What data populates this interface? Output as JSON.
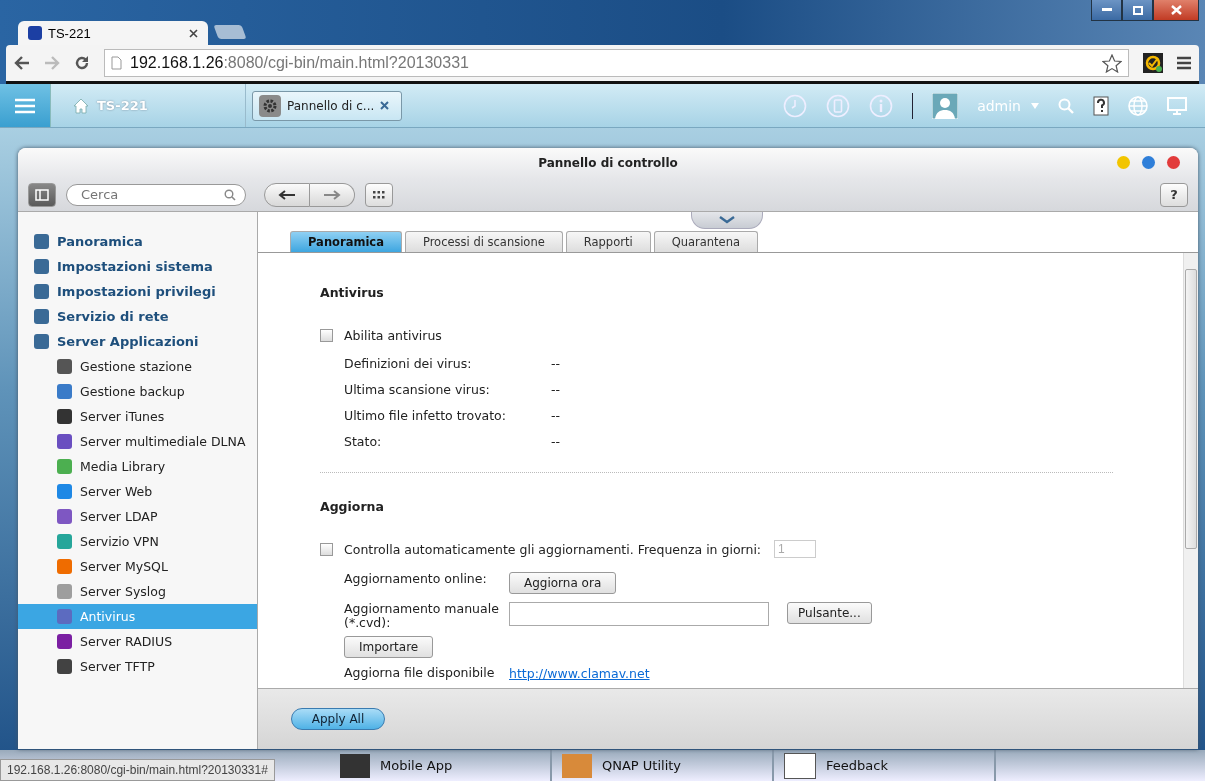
{
  "browser": {
    "tab_title": "TS-221",
    "url_host": "192.168.1.26",
    "url_path": ":8080/cgi-bin/main.html?20130331"
  },
  "topbar": {
    "home_label": "TS-221",
    "app_tab": "Pannello di c...",
    "user": "admin"
  },
  "window": {
    "title": "Pannello di controllo",
    "search": {
      "placeholder": "Cerca"
    },
    "help": "?"
  },
  "sidebar": {
    "items": [
      {
        "label": "Panoramica",
        "selected": false
      },
      {
        "label": "Impostazioni sistema",
        "selected": false
      },
      {
        "label": "Impostazioni privilegi",
        "selected": false
      },
      {
        "label": "Servizio di rete",
        "selected": false
      },
      {
        "label": "Server Applicazioni",
        "selected": false,
        "children": [
          {
            "label": "Gestione stazione",
            "selected": false
          },
          {
            "label": "Gestione backup",
            "selected": false
          },
          {
            "label": "Server iTunes",
            "selected": false
          },
          {
            "label": "Server multimediale DLNA",
            "selected": false
          },
          {
            "label": "Media Library",
            "selected": false
          },
          {
            "label": "Server Web",
            "selected": false
          },
          {
            "label": "Server LDAP",
            "selected": false
          },
          {
            "label": "Servizio VPN",
            "selected": false
          },
          {
            "label": "Server MySQL",
            "selected": false
          },
          {
            "label": "Server Syslog",
            "selected": false
          },
          {
            "label": "Antivirus",
            "selected": true
          },
          {
            "label": "Server RADIUS",
            "selected": false
          },
          {
            "label": "Server TFTP",
            "selected": false
          }
        ]
      }
    ]
  },
  "tabs": [
    {
      "label": "Panoramica",
      "selected": true
    },
    {
      "label": "Processi di scansione",
      "selected": false
    },
    {
      "label": "Rapporti",
      "selected": false
    },
    {
      "label": "Quarantena",
      "selected": false
    }
  ],
  "antivirus": {
    "heading": "Antivirus",
    "enable": {
      "label": "Abilita antivirus",
      "checked": false
    },
    "fields": [
      {
        "label": "Definizioni dei virus:",
        "value": "--"
      },
      {
        "label": "Ultima scansione virus:",
        "value": "--"
      },
      {
        "label": "Ultimo file infetto trovato:",
        "value": "--"
      },
      {
        "label": "Stato:",
        "value": "--"
      }
    ]
  },
  "update": {
    "heading": "Aggiorna",
    "auto": {
      "label": "Controlla automaticamente gli aggiornamenti. Frequenza in giorni:",
      "checked": false,
      "value": "1",
      "disabled": true
    },
    "online": {
      "label": "Aggiornamento online:",
      "button": "Aggiorna ora"
    },
    "manual": {
      "label": "Aggiornamento manuale (*.cvd):",
      "browse": "Pulsante...",
      "import": "Importare"
    },
    "source": {
      "label": "Aggiorna file disponibile",
      "link": "http://www.clamav.net"
    }
  },
  "footer": {
    "apply": "Apply All"
  },
  "dock": [
    "Mobile App",
    "QNAP Utility",
    "Feedback"
  ],
  "status_url": "192.168.1.26:8080/cgi-bin/main.html?20130331#"
}
